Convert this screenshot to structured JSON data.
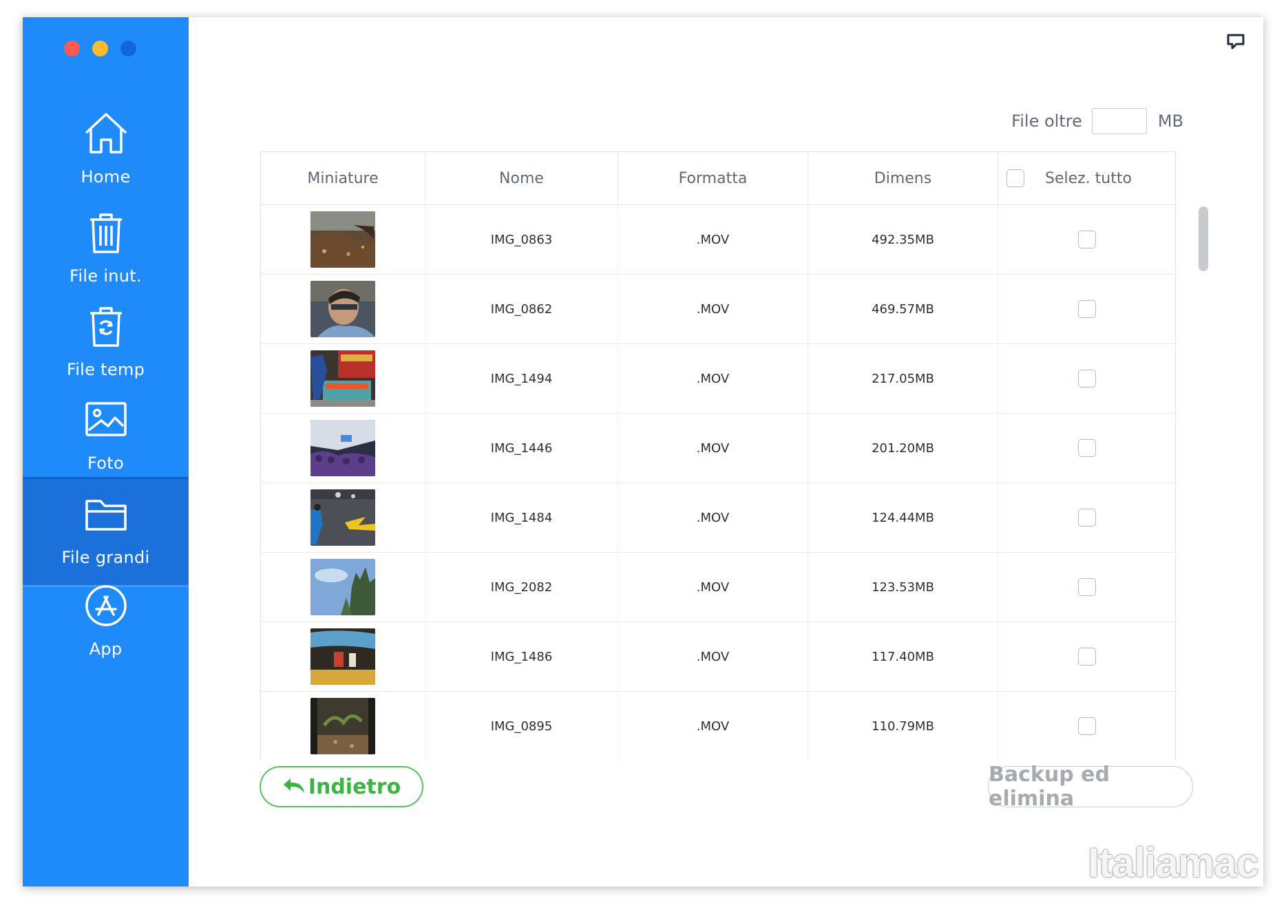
{
  "sidebar": {
    "items": [
      {
        "label": "Home",
        "icon": "home-icon",
        "active": false
      },
      {
        "label": "File inut.",
        "icon": "trash-icon",
        "active": false
      },
      {
        "label": "File temp",
        "icon": "temp-trash-icon",
        "active": false
      },
      {
        "label": "Foto",
        "icon": "photo-icon",
        "active": false
      },
      {
        "label": "File grandi",
        "icon": "folder-icon",
        "active": true
      },
      {
        "label": "App",
        "icon": "app-store-icon",
        "active": false
      }
    ]
  },
  "filter": {
    "label": "File oltre",
    "value": "",
    "unit": "MB"
  },
  "table": {
    "headers": {
      "thumb": "Miniature",
      "name": "Nome",
      "format": "Formatta",
      "size": "Dimens",
      "select_all": "Selez. tutto"
    },
    "rows": [
      {
        "name": "IMG_0863",
        "format": ".MOV",
        "size": "492.35MB",
        "checked": false
      },
      {
        "name": "IMG_0862",
        "format": ".MOV",
        "size": "469.57MB",
        "checked": false
      },
      {
        "name": "IMG_1494",
        "format": ".MOV",
        "size": "217.05MB",
        "checked": false
      },
      {
        "name": "IMG_1446",
        "format": ".MOV",
        "size": "201.20MB",
        "checked": false
      },
      {
        "name": "IMG_1484",
        "format": ".MOV",
        "size": "124.44MB",
        "checked": false
      },
      {
        "name": "IMG_2082",
        "format": ".MOV",
        "size": "123.53MB",
        "checked": false
      },
      {
        "name": "IMG_1486",
        "format": ".MOV",
        "size": "117.40MB",
        "checked": false
      },
      {
        "name": "IMG_0895",
        "format": ".MOV",
        "size": "110.79MB",
        "checked": false
      }
    ]
  },
  "buttons": {
    "back": "Indietro",
    "backup": "Backup ed elimina"
  },
  "watermark": "Italiamac",
  "colors": {
    "sidebar": "#1f8bfb",
    "sidebar_active": "#1b71d9",
    "back_button": "#3bb443",
    "disabled_button": "#a6abb1"
  }
}
